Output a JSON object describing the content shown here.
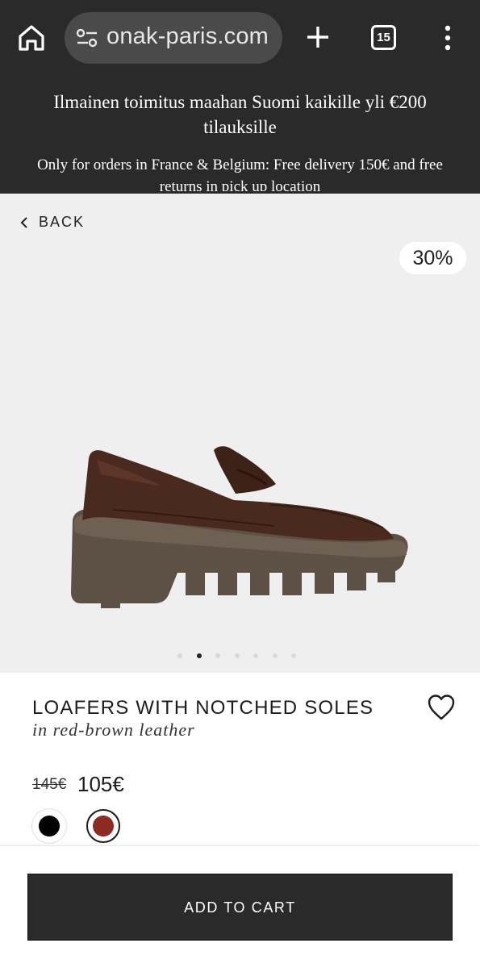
{
  "browser": {
    "url": "onak-paris.com",
    "tab_count": "15",
    "icons": [
      "home-icon",
      "site-settings-icon",
      "new-tab-icon",
      "tab-switcher-icon",
      "more-menu-icon"
    ]
  },
  "promo": {
    "line1": "Ilmainen toimitus maahan Suomi kaikille yli €200 tilauksille",
    "line2": "Only for orders in France & Belgium: Free delivery 150€ and free returns in pick up location"
  },
  "gallery": {
    "back_label": "BACK",
    "discount": "30%",
    "image_count": 7,
    "active_index": 1
  },
  "product": {
    "title": "LOAFERS WITH NOTCHED SOLES",
    "subtitle": "in red-brown leather",
    "price_old": "145€",
    "price_new": "105€",
    "colors": [
      {
        "name": "black",
        "hex": "#000000",
        "selected": false
      },
      {
        "name": "red-brown",
        "hex": "#8f2a22",
        "selected": true
      }
    ]
  },
  "cart": {
    "label": "ADD TO CART"
  },
  "theme": {
    "dark": "#2a2a2a",
    "gallery_bg": "#efefef"
  }
}
